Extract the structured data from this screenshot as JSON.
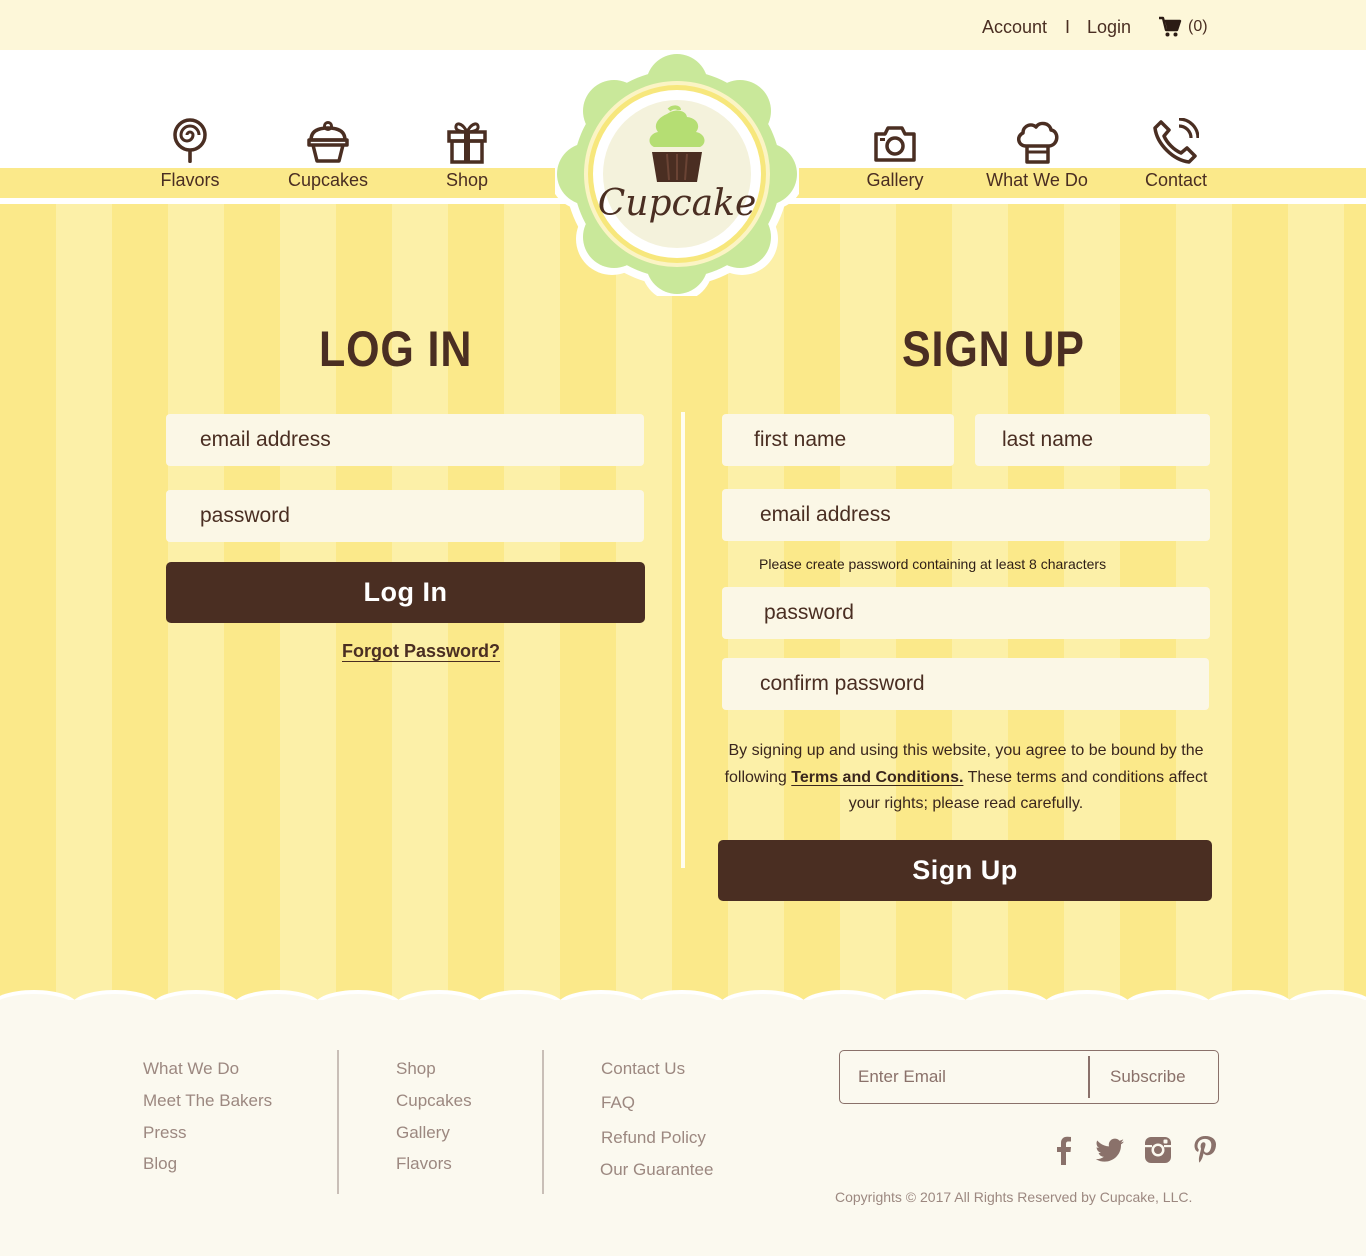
{
  "topbar": {
    "account": "Account",
    "separator": "I",
    "login": "Login",
    "cart_count": "(0)"
  },
  "nav": {
    "left": [
      {
        "label": "Flavors",
        "icon": "lollipop-icon"
      },
      {
        "label": "Cupcakes",
        "icon": "cupcake-icon"
      },
      {
        "label": "Shop",
        "icon": "gift-icon"
      }
    ],
    "right": [
      {
        "label": "Gallery",
        "icon": "camera-icon"
      },
      {
        "label": "What We Do",
        "icon": "chef-hat-icon"
      },
      {
        "label": "Contact",
        "icon": "phone-icon"
      }
    ]
  },
  "logo": {
    "text": "Cupcake"
  },
  "login": {
    "heading": "LOG IN",
    "email_placeholder": "email address",
    "password_placeholder": "password",
    "button": "Log In",
    "forgot": "Forgot Password?"
  },
  "signup": {
    "heading": "SIGN UP",
    "first_name_placeholder": "first name",
    "last_name_placeholder": "last name",
    "email_placeholder": "email address",
    "password_hint": "Please create password containing at least 8 characters",
    "password_placeholder": "password",
    "confirm_placeholder": "confirm password",
    "terms_before": "By signing up and using this website, you agree to be bound by the following ",
    "terms_link": "Terms and Conditions.",
    "terms_after": " These terms and conditions affect your rights; please read carefully.",
    "button": "Sign Up"
  },
  "footer": {
    "col1": [
      "What We Do",
      "Meet The Bakers",
      "Press",
      "Blog"
    ],
    "col2": [
      "Shop",
      "Cupcakes",
      "Gallery",
      "Flavors"
    ],
    "col3": [
      "Contact Us",
      "FAQ",
      "Refund Policy",
      "Our Guarantee"
    ],
    "subscribe_placeholder": "Enter Email",
    "subscribe_button": "Subscribe",
    "social": [
      "facebook-icon",
      "twitter-icon",
      "instagram-icon",
      "pinterest-icon"
    ],
    "copyright": "Copyrights © 2017 All Rights Reserved by Cupcake, LLC."
  },
  "colors": {
    "brown": "#4a2e22",
    "stripe_dark": "#fbe98a",
    "stripe_light": "#fcf0a8",
    "field_bg": "#fbf7e6",
    "logo_green": "#c9e89a",
    "footer_text": "#9c8880"
  }
}
